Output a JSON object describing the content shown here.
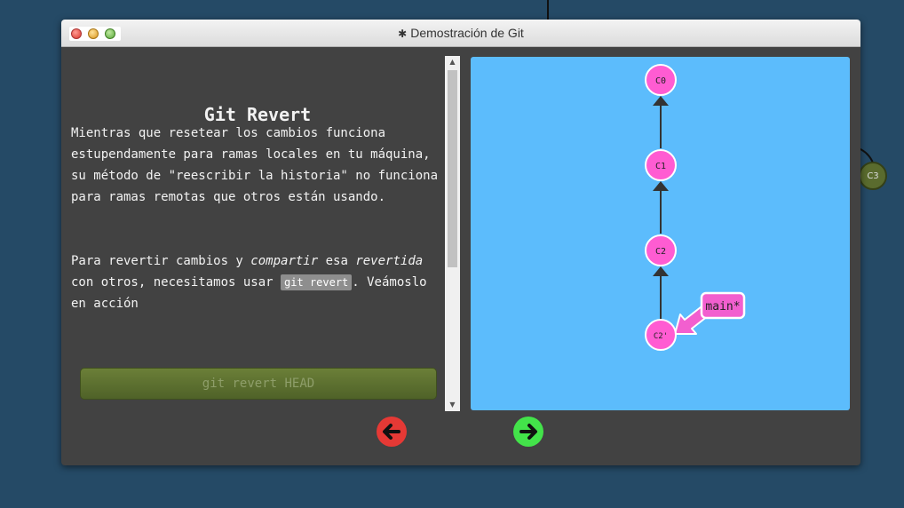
{
  "window": {
    "title": "Demostración de Git"
  },
  "lesson": {
    "title": "Git Revert",
    "paragraph1": "Mientras que resetear los cambios funciona estupendamente para ramas locales en tu máquina, su método de \"reescribir la historia\" no funciona para ramas remotas que otros están usando.",
    "paragraph2_a": "Para revertir cambios y ",
    "paragraph2_em1": "compartir",
    "paragraph2_b": " esa ",
    "paragraph2_em2": "revertida",
    "paragraph2_c": " con otros, necesitamos usar ",
    "paragraph2_code": "git revert",
    "paragraph2_d": ". Veámoslo en acción",
    "command_button": "git revert HEAD"
  },
  "tree": {
    "commits": [
      "C0",
      "C1",
      "C2",
      "C2'"
    ],
    "branch_label": "main*"
  },
  "background": {
    "node_label": "C3"
  },
  "icons": {
    "back": "arrow-left-icon",
    "forward": "arrow-right-icon",
    "settings": "gear-icon"
  },
  "colors": {
    "background": "#254a66",
    "window": "#424242",
    "viz_background": "#5cbcfc",
    "commit_node": "#ff5cd2",
    "branch_tag": "#f25fcf",
    "command_button": "#5a6e30",
    "back_button": "#e53935",
    "forward_button": "#43e34a"
  }
}
